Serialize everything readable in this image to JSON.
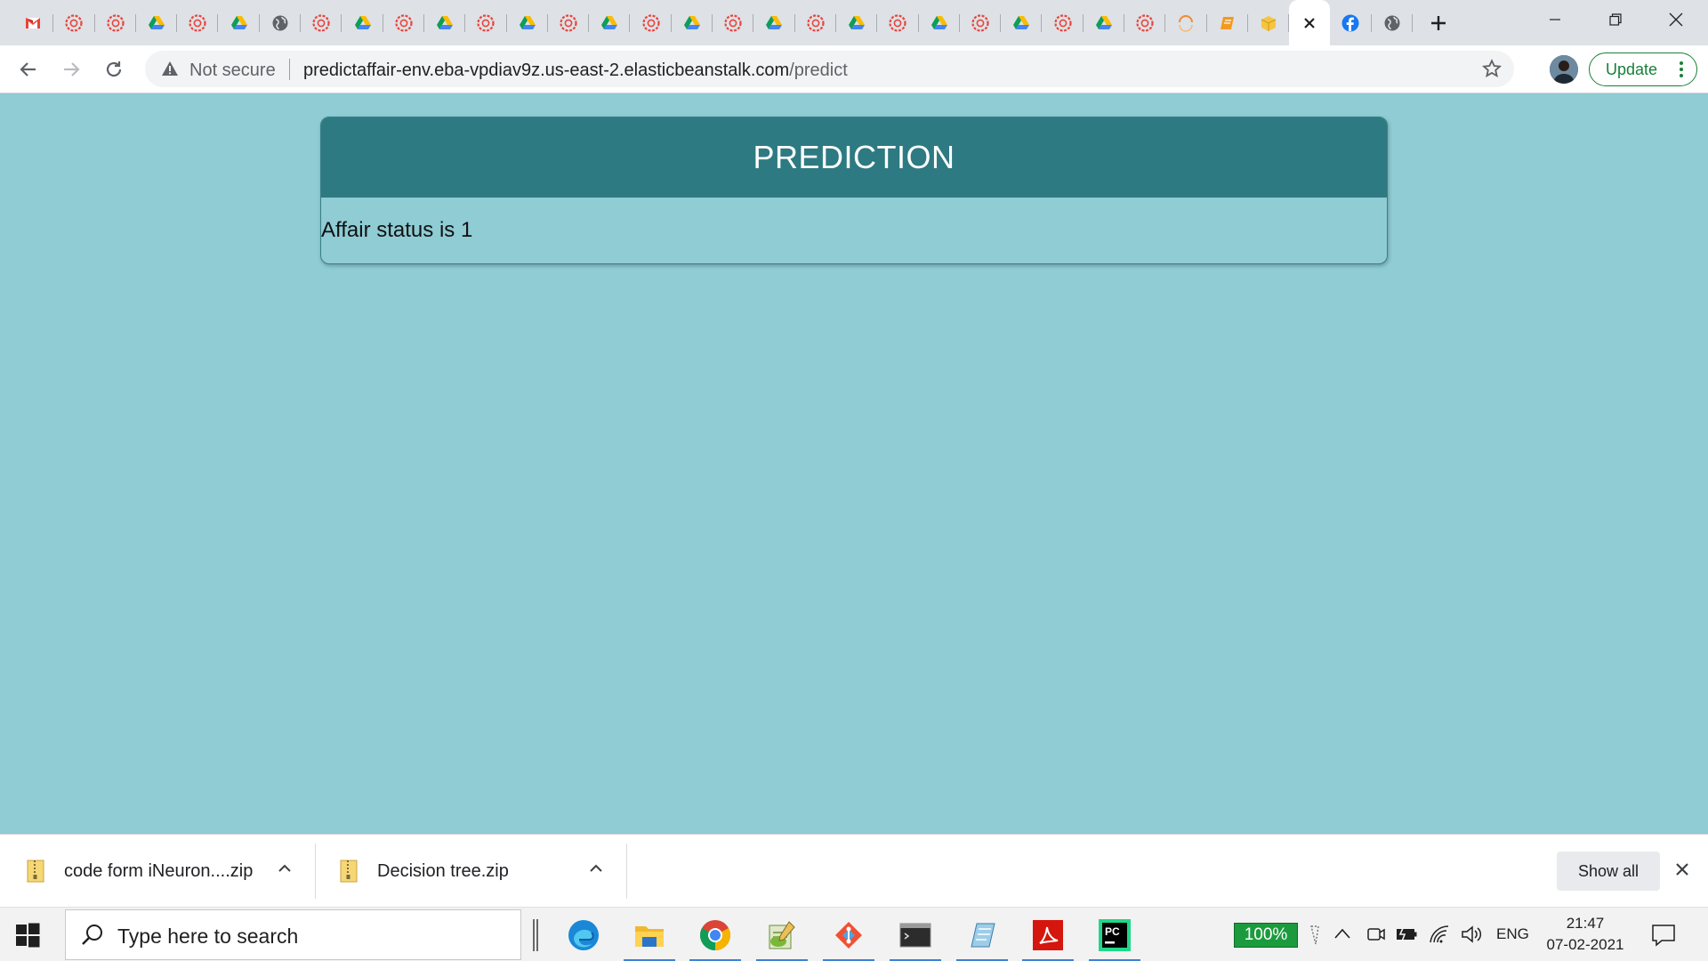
{
  "browser": {
    "tabs": [
      {
        "icon": "gmail-icon"
      },
      {
        "icon": "ineuron-icon"
      },
      {
        "icon": "ineuron-icon"
      },
      {
        "icon": "google-drive-icon"
      },
      {
        "icon": "ineuron-icon"
      },
      {
        "icon": "google-drive-icon"
      },
      {
        "icon": "globe-icon"
      },
      {
        "icon": "ineuron-icon"
      },
      {
        "icon": "google-drive-icon"
      },
      {
        "icon": "ineuron-icon"
      },
      {
        "icon": "google-drive-icon"
      },
      {
        "icon": "ineuron-icon"
      },
      {
        "icon": "google-drive-icon"
      },
      {
        "icon": "ineuron-icon"
      },
      {
        "icon": "google-drive-icon"
      },
      {
        "icon": "ineuron-icon"
      },
      {
        "icon": "google-drive-icon"
      },
      {
        "icon": "ineuron-icon"
      },
      {
        "icon": "google-drive-icon"
      },
      {
        "icon": "ineuron-icon"
      },
      {
        "icon": "google-drive-icon"
      },
      {
        "icon": "ineuron-icon"
      },
      {
        "icon": "google-drive-icon"
      },
      {
        "icon": "ineuron-icon"
      },
      {
        "icon": "google-drive-icon"
      },
      {
        "icon": "ineuron-icon"
      },
      {
        "icon": "google-drive-icon"
      },
      {
        "icon": "ineuron-icon"
      },
      {
        "icon": "loading-ring-icon"
      },
      {
        "icon": "orange-book-icon"
      },
      {
        "icon": "yellow-box-icon"
      },
      {
        "icon": "close-icon",
        "active": true
      },
      {
        "icon": "facebook-icon"
      },
      {
        "icon": "globe-icon"
      }
    ],
    "address": {
      "security_label": "Not secure",
      "host": "predictaffair-env.eba-vpdiav9z.us-east-2.elasticbeanstalk.com",
      "path": "/predict"
    },
    "update_label": "Update"
  },
  "page": {
    "header": "PREDICTION",
    "result": "Affair status is 1"
  },
  "downloads": {
    "items": [
      {
        "name": "code form iNeuron....zip"
      },
      {
        "name": "Decision tree.zip"
      }
    ],
    "show_all_label": "Show all"
  },
  "taskbar": {
    "search_placeholder": "Type here to search",
    "battery_percent": "100%",
    "language": "ENG",
    "time": "21:47",
    "date": "07-02-2021"
  },
  "colors": {
    "page_bg": "#8fccd4",
    "card_header": "#2e7a82",
    "update_green": "#188038"
  }
}
